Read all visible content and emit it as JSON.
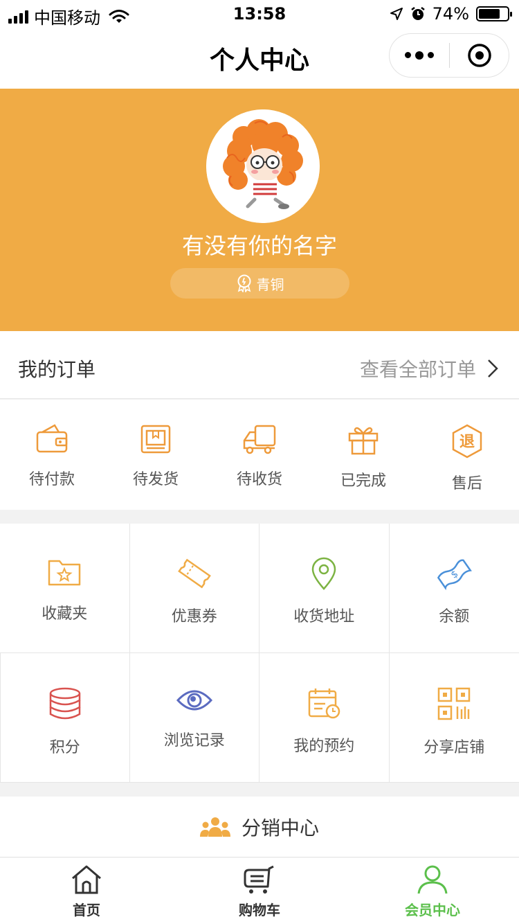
{
  "status_bar": {
    "carrier": "中国移动",
    "time": "13:58",
    "battery_text": "74%",
    "battery_level": 0.74
  },
  "nav": {
    "title": "个人中心"
  },
  "profile": {
    "username": "有没有你的名字",
    "level": "青铜",
    "banner_color": "#f0ab45"
  },
  "orders": {
    "title": "我的订单",
    "view_all": "查看全部订单",
    "items": [
      {
        "label": "待付款",
        "icon": "wallet-icon"
      },
      {
        "label": "待发货",
        "icon": "package-icon"
      },
      {
        "label": "待收货",
        "icon": "truck-icon"
      },
      {
        "label": "已完成",
        "icon": "gift-icon"
      },
      {
        "label": "售后",
        "icon": "refund-icon",
        "glyph": "退"
      }
    ]
  },
  "services": [
    {
      "label": "收藏夹",
      "icon": "star-folder-icon",
      "color": "#f0ab45"
    },
    {
      "label": "优惠券",
      "icon": "ticket-icon",
      "color": "#f0ab45"
    },
    {
      "label": "收货地址",
      "icon": "location-pin-icon",
      "color": "#7cb342"
    },
    {
      "label": "余额",
      "icon": "money-bill-icon",
      "color": "#4a90d9"
    },
    {
      "label": "积分",
      "icon": "coins-icon",
      "color": "#d9534f"
    },
    {
      "label": "浏览记录",
      "icon": "eye-icon",
      "color": "#5b6bc0"
    },
    {
      "label": "我的预约",
      "icon": "calendar-icon",
      "color": "#f0ab45"
    },
    {
      "label": "分享店铺",
      "icon": "qrcode-icon",
      "color": "#f0ab45"
    }
  ],
  "distribution": {
    "label": "分销中心",
    "icon": "people-icon"
  },
  "tab_bar": {
    "items": [
      {
        "label": "首页",
        "icon": "home-icon"
      },
      {
        "label": "购物车",
        "icon": "cart-icon"
      },
      {
        "label": "会员中心",
        "icon": "user-icon",
        "active": true
      }
    ],
    "active_color": "#5bbf4b"
  }
}
